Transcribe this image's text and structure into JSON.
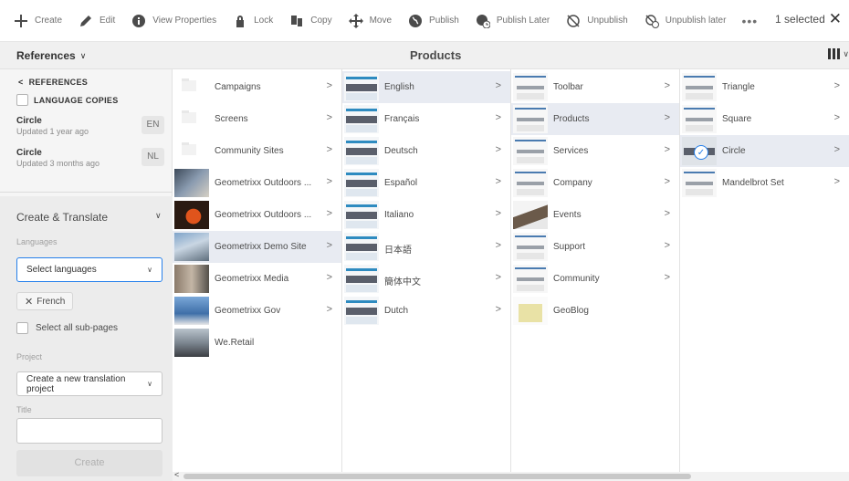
{
  "toolbar": {
    "create": "Create",
    "edit": "Edit",
    "view_properties": "View Properties",
    "lock": "Lock",
    "copy": "Copy",
    "move": "Move",
    "publish": "Publish",
    "publish_later": "Publish Later",
    "unpublish": "Unpublish",
    "unpublish_later": "Unpublish later",
    "more": "•••",
    "selected": "1 selected"
  },
  "titlebar": {
    "rail_switcher": "References",
    "title": "Products"
  },
  "rail": {
    "back_label": "REFERENCES",
    "language_copies": "LANGUAGE COPIES",
    "references": [
      {
        "name": "Circle",
        "updated": "Updated 1 year ago",
        "lang": "EN"
      },
      {
        "name": "Circle",
        "updated": "Updated 3 months ago",
        "lang": "NL"
      }
    ],
    "create_translate": {
      "header": "Create & Translate",
      "languages_label": "Languages",
      "languages_placeholder": "Select languages",
      "chip": "French",
      "select_all_subpages": "Select all sub-pages",
      "project_label": "Project",
      "project_value": "Create a new translation project",
      "title_label": "Title",
      "title_value": "",
      "create_button": "Create"
    }
  },
  "columns": [
    {
      "items": [
        {
          "label": "Campaigns",
          "thumb": "folder",
          "has_children": true,
          "selected": false
        },
        {
          "label": "Screens",
          "thumb": "folder",
          "has_children": true,
          "selected": false
        },
        {
          "label": "Community Sites",
          "thumb": "folder",
          "has_children": true,
          "selected": false
        },
        {
          "label": "Geometrixx Outdoors ...",
          "thumb": "photo1",
          "has_children": true,
          "selected": false
        },
        {
          "label": "Geometrixx Outdoors ...",
          "thumb": "photo2",
          "has_children": true,
          "selected": false
        },
        {
          "label": "Geometrixx Demo Site",
          "thumb": "photo3",
          "has_children": true,
          "selected": true
        },
        {
          "label": "Geometrixx Media",
          "thumb": "photo4",
          "has_children": true,
          "selected": false
        },
        {
          "label": "Geometrixx Gov",
          "thumb": "photo5",
          "has_children": true,
          "selected": false
        },
        {
          "label": "We.Retail",
          "thumb": "photo6",
          "has_children": false,
          "selected": false
        }
      ]
    },
    {
      "items": [
        {
          "label": "English",
          "thumb": "web",
          "has_children": true,
          "selected": true
        },
        {
          "label": "Français",
          "thumb": "web",
          "has_children": true,
          "selected": false
        },
        {
          "label": "Deutsch",
          "thumb": "web",
          "has_children": true,
          "selected": false
        },
        {
          "label": "Español",
          "thumb": "web",
          "has_children": true,
          "selected": false
        },
        {
          "label": "Italiano",
          "thumb": "web",
          "has_children": true,
          "selected": false
        },
        {
          "label": "日本語",
          "thumb": "web",
          "has_children": true,
          "selected": false
        },
        {
          "label": "簡体中文",
          "thumb": "web",
          "has_children": true,
          "selected": false
        },
        {
          "label": "Dutch",
          "thumb": "web",
          "has_children": true,
          "selected": false
        }
      ]
    },
    {
      "items": [
        {
          "label": "Toolbar",
          "thumb": "page",
          "has_children": true,
          "selected": false
        },
        {
          "label": "Products",
          "thumb": "page",
          "has_children": true,
          "selected": true
        },
        {
          "label": "Services",
          "thumb": "page",
          "has_children": true,
          "selected": false
        },
        {
          "label": "Company",
          "thumb": "page",
          "has_children": true,
          "selected": false
        },
        {
          "label": "Events",
          "thumb": "mountain",
          "has_children": true,
          "selected": false
        },
        {
          "label": "Support",
          "thumb": "page",
          "has_children": true,
          "selected": false
        },
        {
          "label": "Community",
          "thumb": "page",
          "has_children": true,
          "selected": false
        },
        {
          "label": "GeoBlog",
          "thumb": "blog",
          "has_children": false,
          "selected": false
        }
      ]
    },
    {
      "items": [
        {
          "label": "Triangle",
          "thumb": "page",
          "has_children": true,
          "selected": false
        },
        {
          "label": "Square",
          "thumb": "page",
          "has_children": true,
          "selected": false
        },
        {
          "label": "Circle",
          "thumb": "check",
          "has_children": true,
          "selected": true
        },
        {
          "label": "Mandelbrot Set",
          "thumb": "page",
          "has_children": true,
          "selected": false
        }
      ]
    }
  ],
  "colors": {
    "accent": "#2680eb",
    "selected_row": "#e8ebf2",
    "rail_bg": "#f5f5f5"
  },
  "icons": {
    "create": "plus-icon",
    "edit": "pencil-icon",
    "view_properties": "info-icon",
    "lock": "lock-icon",
    "copy": "copy-icon",
    "move": "move-icon",
    "publish": "globe-icon",
    "publish_later": "globe-clock-icon",
    "unpublish": "globe-off-icon",
    "unpublish_later": "globe-off-clock-icon",
    "close": "close-icon",
    "view": "column-view-icon"
  }
}
